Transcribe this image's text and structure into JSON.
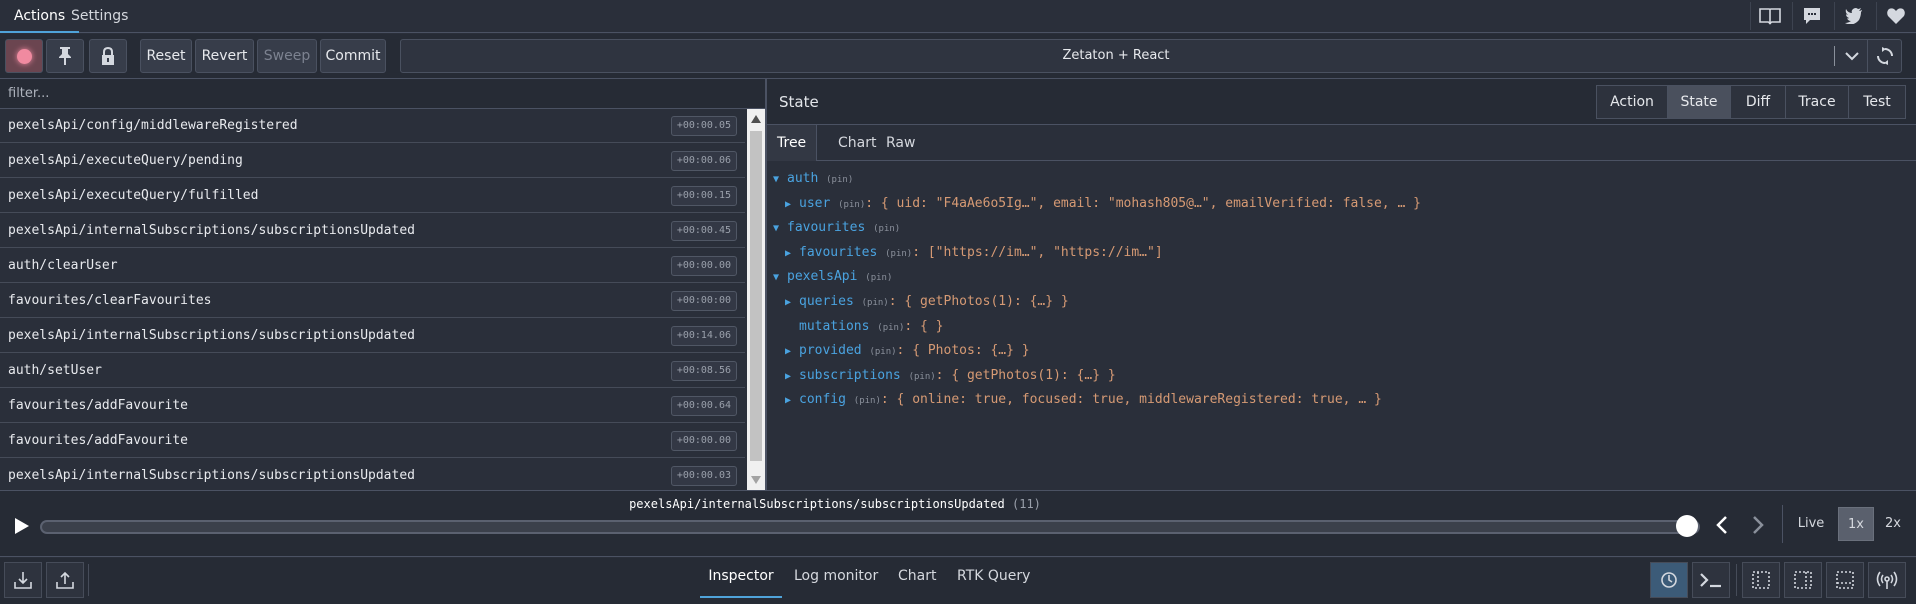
{
  "top_tabs": [
    {
      "label": "Actions",
      "active": true
    },
    {
      "label": "Settings",
      "active": false
    }
  ],
  "top_icons": [
    "book-icon",
    "chat-icon",
    "twitter-icon",
    "heart-icon"
  ],
  "toolbar": {
    "reset_label": "Reset",
    "revert_label": "Revert",
    "sweep_label": "Sweep",
    "commit_label": "Commit",
    "instance": "Zetaton + React"
  },
  "filter": {
    "placeholder": "filter..."
  },
  "actions": [
    {
      "name": "pexelsApi/config/middlewareRegistered",
      "time": "+00:00.05"
    },
    {
      "name": "pexelsApi/executeQuery/pending",
      "time": "+00:00.06"
    },
    {
      "name": "pexelsApi/executeQuery/fulfilled",
      "time": "+00:00.15"
    },
    {
      "name": "pexelsApi/internalSubscriptions/subscriptionsUpdated",
      "time": "+00:00.45"
    },
    {
      "name": "auth/clearUser",
      "time": "+00:00.00"
    },
    {
      "name": "favourites/clearFavourites",
      "time": "+00:00:00"
    },
    {
      "name": "pexelsApi/internalSubscriptions/subscriptionsUpdated",
      "time": "+00:14.06"
    },
    {
      "name": "auth/setUser",
      "time": "+00:08.56"
    },
    {
      "name": "favourites/addFavourite",
      "time": "+00:00.64"
    },
    {
      "name": "favourites/addFavourite",
      "time": "+00:00.00"
    },
    {
      "name": "pexelsApi/internalSubscriptions/subscriptionsUpdated",
      "time": "+00:00.03"
    }
  ],
  "state_panel": {
    "title": "State",
    "monitor_tabs": [
      "Action",
      "State",
      "Diff",
      "Trace",
      "Test"
    ],
    "active_monitor_tab": "State",
    "sub_tabs": [
      "Tree",
      "Chart",
      "Raw"
    ],
    "active_sub_tab": "Tree",
    "pin_label": "(pin)",
    "tree": [
      {
        "arrow": "▼",
        "key": "auth",
        "value": ""
      },
      {
        "arrow": "▶",
        "key": "user",
        "value": ": { uid: \"F4aAe6o5Ig…\", email: \"mohash805@…\", emailVerified: false, … }"
      },
      {
        "arrow": "▼",
        "key": "favourites",
        "value": ""
      },
      {
        "arrow": "▶",
        "key": "favourites",
        "value": ": [\"https://im…\", \"https://im…\"]"
      },
      {
        "arrow": "▼",
        "key": "pexelsApi",
        "value": ""
      },
      {
        "arrow": "▶",
        "key": "queries",
        "value": ": { getPhotos(1): {…} }"
      },
      {
        "arrow": "",
        "key": "mutations",
        "value": ": { }"
      },
      {
        "arrow": "▶",
        "key": "provided",
        "value": ": { Photos: {…} }"
      },
      {
        "arrow": "▶",
        "key": "subscriptions",
        "value": ": { getPhotos(1): {…} }"
      },
      {
        "arrow": "▶",
        "key": "config",
        "value": ": { online: true, focused: true, middlewareRegistered: true, … }"
      }
    ]
  },
  "slider": {
    "current_action": "pexelsApi/internalSubscriptions/subscriptionsUpdated",
    "count": "(11)",
    "position_fraction": 1.0,
    "live_label": "Live",
    "speed_options": [
      "1x",
      "2x"
    ],
    "active_speed": "1x"
  },
  "bottom_tabs": [
    "Inspector",
    "Log monitor",
    "Chart",
    "RTK Query"
  ],
  "active_bottom_tab": "Inspector",
  "colors": {
    "accent": "#4fa3d9",
    "key": "#4aa3e0",
    "value": "#d69a74",
    "background": "#2a2f3a"
  }
}
